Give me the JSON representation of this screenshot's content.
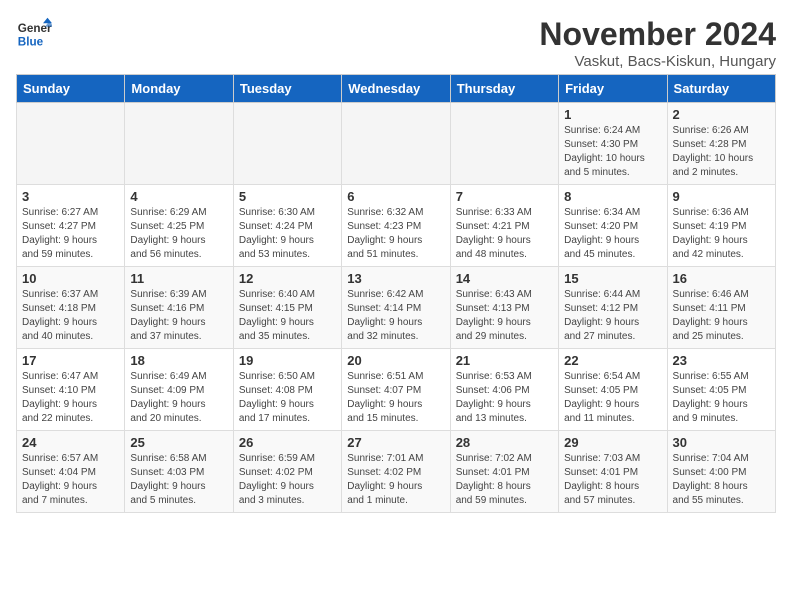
{
  "logo": {
    "line1": "General",
    "line2": "Blue"
  },
  "title": "November 2024",
  "subtitle": "Vaskut, Bacs-Kiskun, Hungary",
  "days_header": [
    "Sunday",
    "Monday",
    "Tuesday",
    "Wednesday",
    "Thursday",
    "Friday",
    "Saturday"
  ],
  "weeks": [
    [
      {
        "day": "",
        "info": ""
      },
      {
        "day": "",
        "info": ""
      },
      {
        "day": "",
        "info": ""
      },
      {
        "day": "",
        "info": ""
      },
      {
        "day": "",
        "info": ""
      },
      {
        "day": "1",
        "info": "Sunrise: 6:24 AM\nSunset: 4:30 PM\nDaylight: 10 hours\nand 5 minutes."
      },
      {
        "day": "2",
        "info": "Sunrise: 6:26 AM\nSunset: 4:28 PM\nDaylight: 10 hours\nand 2 minutes."
      }
    ],
    [
      {
        "day": "3",
        "info": "Sunrise: 6:27 AM\nSunset: 4:27 PM\nDaylight: 9 hours\nand 59 minutes."
      },
      {
        "day": "4",
        "info": "Sunrise: 6:29 AM\nSunset: 4:25 PM\nDaylight: 9 hours\nand 56 minutes."
      },
      {
        "day": "5",
        "info": "Sunrise: 6:30 AM\nSunset: 4:24 PM\nDaylight: 9 hours\nand 53 minutes."
      },
      {
        "day": "6",
        "info": "Sunrise: 6:32 AM\nSunset: 4:23 PM\nDaylight: 9 hours\nand 51 minutes."
      },
      {
        "day": "7",
        "info": "Sunrise: 6:33 AM\nSunset: 4:21 PM\nDaylight: 9 hours\nand 48 minutes."
      },
      {
        "day": "8",
        "info": "Sunrise: 6:34 AM\nSunset: 4:20 PM\nDaylight: 9 hours\nand 45 minutes."
      },
      {
        "day": "9",
        "info": "Sunrise: 6:36 AM\nSunset: 4:19 PM\nDaylight: 9 hours\nand 42 minutes."
      }
    ],
    [
      {
        "day": "10",
        "info": "Sunrise: 6:37 AM\nSunset: 4:18 PM\nDaylight: 9 hours\nand 40 minutes."
      },
      {
        "day": "11",
        "info": "Sunrise: 6:39 AM\nSunset: 4:16 PM\nDaylight: 9 hours\nand 37 minutes."
      },
      {
        "day": "12",
        "info": "Sunrise: 6:40 AM\nSunset: 4:15 PM\nDaylight: 9 hours\nand 35 minutes."
      },
      {
        "day": "13",
        "info": "Sunrise: 6:42 AM\nSunset: 4:14 PM\nDaylight: 9 hours\nand 32 minutes."
      },
      {
        "day": "14",
        "info": "Sunrise: 6:43 AM\nSunset: 4:13 PM\nDaylight: 9 hours\nand 29 minutes."
      },
      {
        "day": "15",
        "info": "Sunrise: 6:44 AM\nSunset: 4:12 PM\nDaylight: 9 hours\nand 27 minutes."
      },
      {
        "day": "16",
        "info": "Sunrise: 6:46 AM\nSunset: 4:11 PM\nDaylight: 9 hours\nand 25 minutes."
      }
    ],
    [
      {
        "day": "17",
        "info": "Sunrise: 6:47 AM\nSunset: 4:10 PM\nDaylight: 9 hours\nand 22 minutes."
      },
      {
        "day": "18",
        "info": "Sunrise: 6:49 AM\nSunset: 4:09 PM\nDaylight: 9 hours\nand 20 minutes."
      },
      {
        "day": "19",
        "info": "Sunrise: 6:50 AM\nSunset: 4:08 PM\nDaylight: 9 hours\nand 17 minutes."
      },
      {
        "day": "20",
        "info": "Sunrise: 6:51 AM\nSunset: 4:07 PM\nDaylight: 9 hours\nand 15 minutes."
      },
      {
        "day": "21",
        "info": "Sunrise: 6:53 AM\nSunset: 4:06 PM\nDaylight: 9 hours\nand 13 minutes."
      },
      {
        "day": "22",
        "info": "Sunrise: 6:54 AM\nSunset: 4:05 PM\nDaylight: 9 hours\nand 11 minutes."
      },
      {
        "day": "23",
        "info": "Sunrise: 6:55 AM\nSunset: 4:05 PM\nDaylight: 9 hours\nand 9 minutes."
      }
    ],
    [
      {
        "day": "24",
        "info": "Sunrise: 6:57 AM\nSunset: 4:04 PM\nDaylight: 9 hours\nand 7 minutes."
      },
      {
        "day": "25",
        "info": "Sunrise: 6:58 AM\nSunset: 4:03 PM\nDaylight: 9 hours\nand 5 minutes."
      },
      {
        "day": "26",
        "info": "Sunrise: 6:59 AM\nSunset: 4:02 PM\nDaylight: 9 hours\nand 3 minutes."
      },
      {
        "day": "27",
        "info": "Sunrise: 7:01 AM\nSunset: 4:02 PM\nDaylight: 9 hours\nand 1 minute."
      },
      {
        "day": "28",
        "info": "Sunrise: 7:02 AM\nSunset: 4:01 PM\nDaylight: 8 hours\nand 59 minutes."
      },
      {
        "day": "29",
        "info": "Sunrise: 7:03 AM\nSunset: 4:01 PM\nDaylight: 8 hours\nand 57 minutes."
      },
      {
        "day": "30",
        "info": "Sunrise: 7:04 AM\nSunset: 4:00 PM\nDaylight: 8 hours\nand 55 minutes."
      }
    ]
  ]
}
